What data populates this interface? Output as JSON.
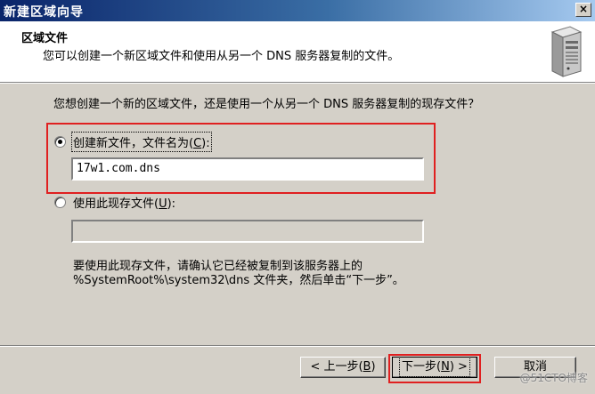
{
  "window": {
    "title": "新建区域向导",
    "close_glyph": "×"
  },
  "header": {
    "title": "区域文件",
    "description": "您可以创建一个新区域文件和使用从另一个 DNS 服务器复制的文件。",
    "icon": "server-icon"
  },
  "question": "您想创建一个新的区域文件，还是使用一个从另一个 DNS 服务器复制的现存文件？",
  "option_new": {
    "label_prefix": "创建新文件，文件名为(",
    "accel": "C",
    "label_suffix": "):",
    "selected": true,
    "filename": "17w1.com.dns"
  },
  "option_existing": {
    "label_prefix": "使用此现存文件(",
    "accel": "U",
    "label_suffix": "):",
    "selected": false,
    "filename": ""
  },
  "note": {
    "line1": "要使用此现存文件，请确认它已经被复制到该服务器上的",
    "line2": "%SystemRoot%\\system32\\dns 文件夹，然后单击“下一步”。"
  },
  "buttons": {
    "back": {
      "prefix": "< 上一步(",
      "accel": "B",
      "suffix": ")"
    },
    "next": {
      "prefix": "下一步(",
      "accel": "N",
      "suffix": ") >"
    },
    "cancel": "取消"
  },
  "watermark": "@51CTO博客",
  "colors": {
    "highlight": "#e02020",
    "titlebar": "#0a246a"
  }
}
